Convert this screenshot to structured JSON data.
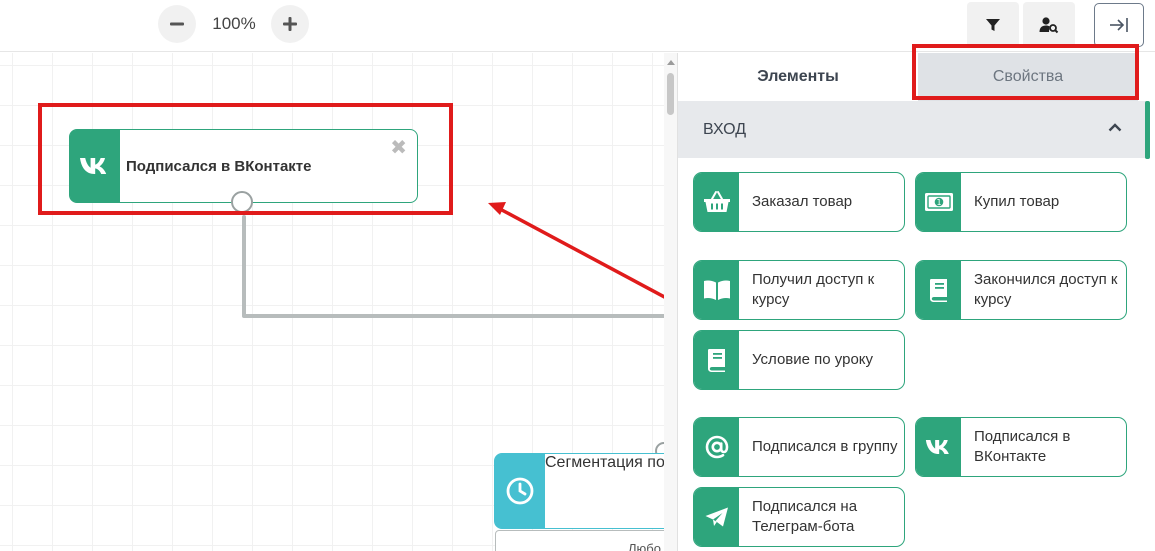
{
  "toolbar": {
    "zoom_level": "100%",
    "zoom_out_icon": "minus-icon",
    "zoom_in_icon": "plus-icon",
    "filter_icon": "filter-icon",
    "user_search_icon": "user-search-icon",
    "collapse_icon": "collapse-right-icon"
  },
  "canvas": {
    "node_vk": {
      "title": "Подписался в ВКонтакте",
      "icon": "vk-icon",
      "close": "✖"
    },
    "node_segment": {
      "title": "Сегментация по",
      "icon": "clock-icon",
      "sub_label": "Любо"
    }
  },
  "panel": {
    "tabs": [
      {
        "label": "Элементы",
        "active": true
      },
      {
        "label": "Свойства",
        "active": false
      }
    ],
    "section": {
      "title": "ВХОД",
      "icon": "chevron-up-icon"
    },
    "items": [
      {
        "label": "Заказал товар",
        "icon": "basket-icon"
      },
      {
        "label": "Купил товар",
        "icon": "money-icon"
      },
      {
        "label": "Получил доступ к курсу",
        "icon": "open-book-icon"
      },
      {
        "label": "Закончился доступ к курсу",
        "icon": "closed-book-icon"
      },
      {
        "label": "Условие по уроку",
        "icon": "book-icon"
      },
      {
        "label": "Подписался в группу",
        "icon": "at-icon"
      },
      {
        "label": "Подписался в ВКонтакте",
        "icon": "vk-icon"
      },
      {
        "label": "Подписался на Телеграм-бота",
        "icon": "telegram-icon"
      }
    ]
  },
  "colors": {
    "accent_green": "#2ea57c",
    "accent_cyan": "#46c0d1",
    "highlight_red": "#e01b1b",
    "connector_grey": "#b7bcbc"
  }
}
